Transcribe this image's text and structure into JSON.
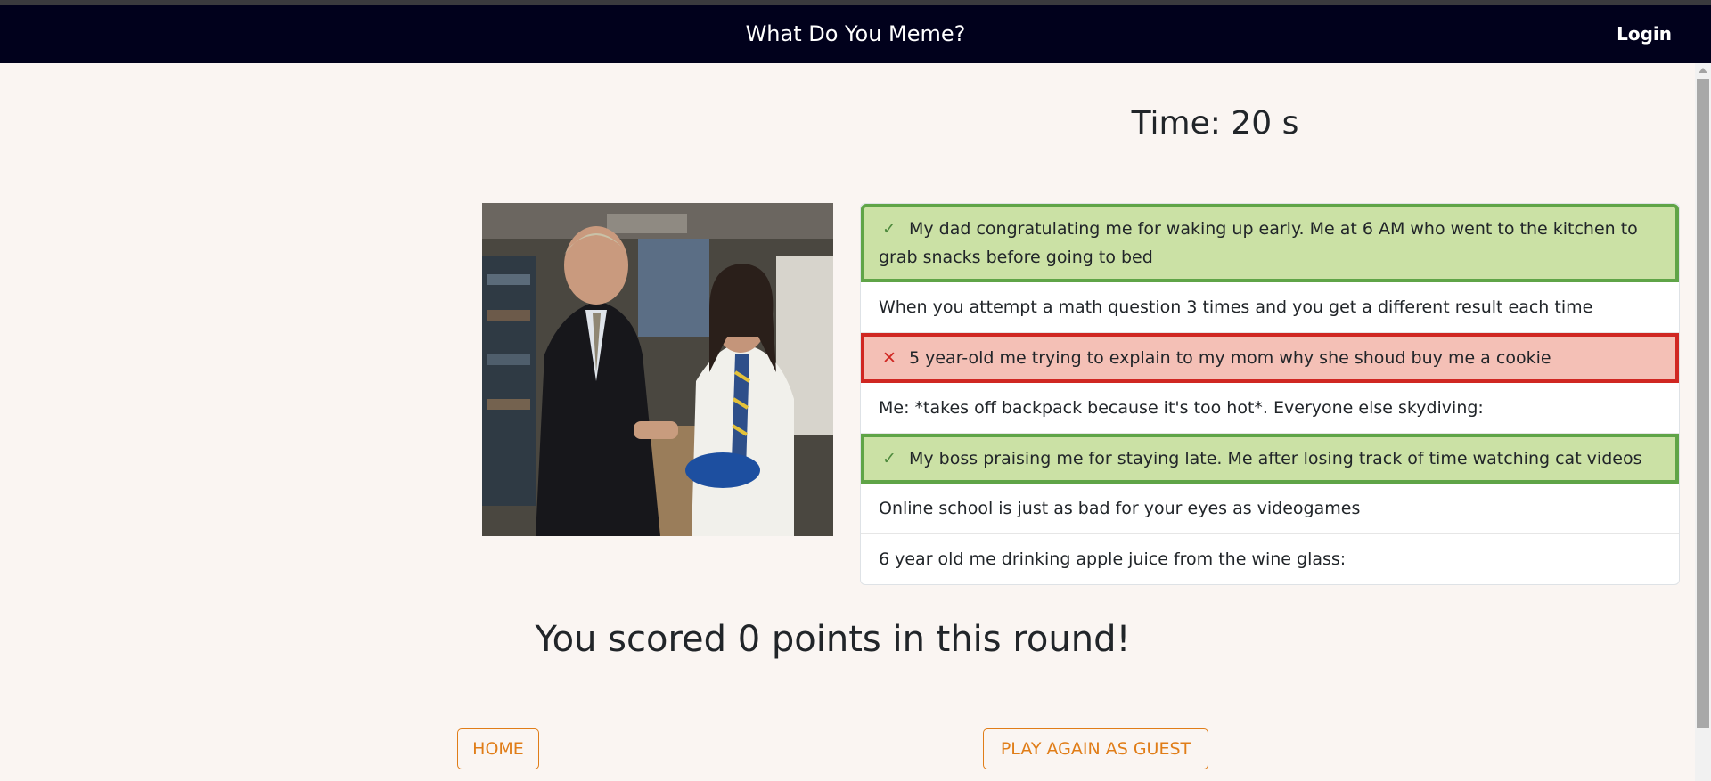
{
  "navbar": {
    "title": "What Do You Meme?",
    "login_label": "Login"
  },
  "game": {
    "timer_text": "Time: 20 s",
    "image_alt": "Meme image: two men shaking hands in an office",
    "captions": [
      {
        "text": "My dad congratulating me for waking up early. Me at 6 AM who went to the kitchen to grab snacks before going to bed",
        "state": "correct",
        "mark": "✓"
      },
      {
        "text": "When you attempt a math question 3 times and you get a different result each time",
        "state": "neutral",
        "mark": ""
      },
      {
        "text": "5 year-old me trying to explain to my mom why she shoud buy me a cookie",
        "state": "wrong",
        "mark": "✕"
      },
      {
        "text": "Me: *takes off backpack because it's too hot*. Everyone else skydiving:",
        "state": "neutral",
        "mark": ""
      },
      {
        "text": "My boss praising me for staying late. Me after losing track of time watching cat videos",
        "state": "correct",
        "mark": "✓"
      },
      {
        "text": "Online school is just as bad for your eyes as videogames",
        "state": "neutral",
        "mark": ""
      },
      {
        "text": "6 year old me drinking apple juice from the wine glass:",
        "state": "neutral",
        "mark": ""
      }
    ],
    "score_text": "You scored 0 points in this round!"
  },
  "buttons": {
    "home_label": "HOME",
    "play_again_label": "PLAY AGAIN AS GUEST"
  },
  "colors": {
    "navbar_bg": "#01011c",
    "page_bg": "#faf5f2",
    "accent": "#e07d18",
    "correct_bg": "#cbe1a5",
    "correct_border": "#5fa447",
    "wrong_bg": "#f4c0b6",
    "wrong_border": "#d02722"
  }
}
